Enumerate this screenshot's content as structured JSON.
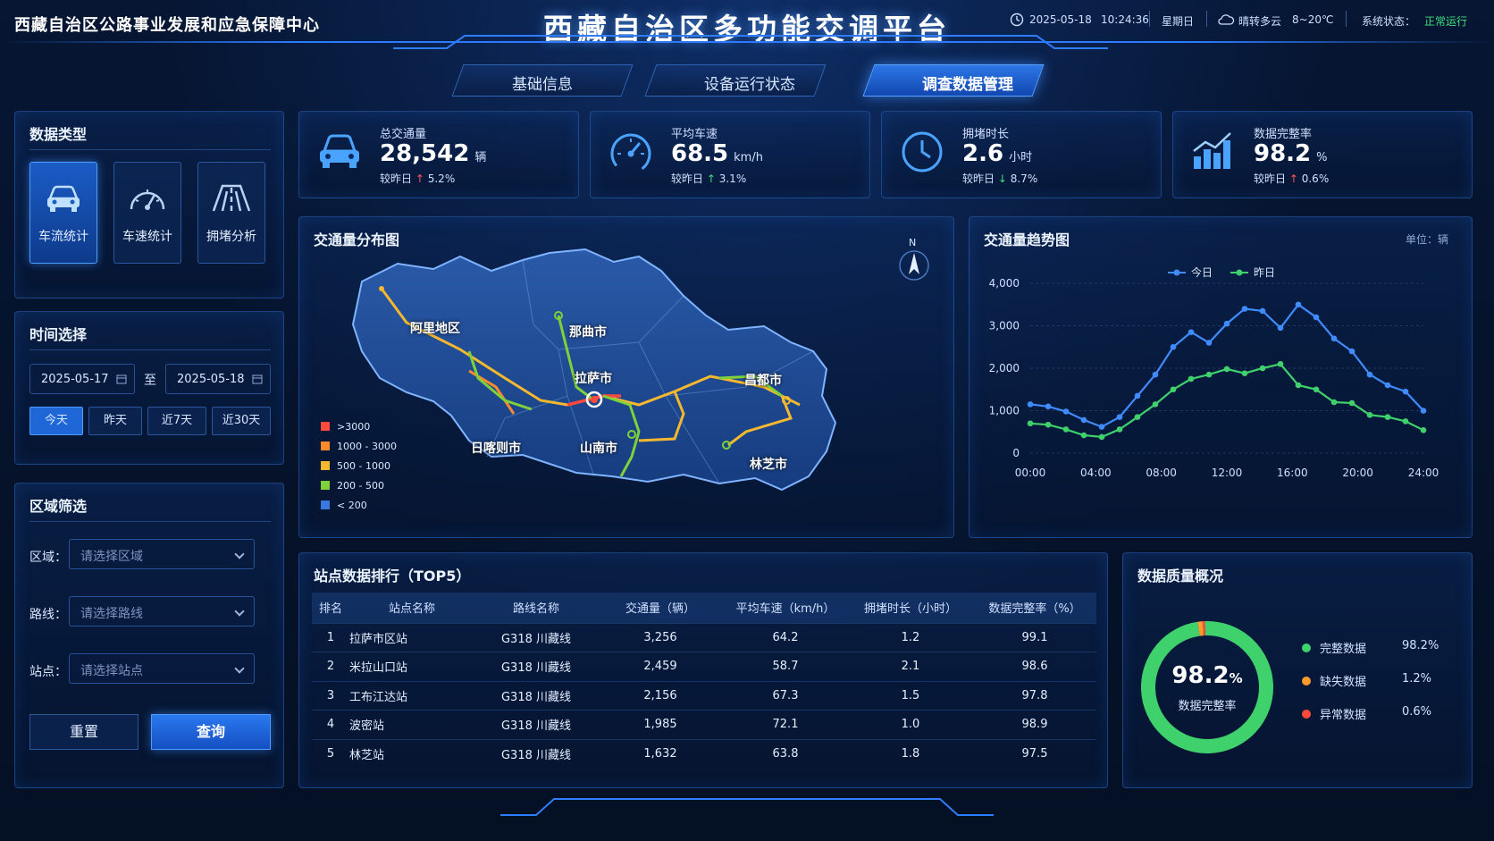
{
  "header": {
    "org": "西藏自治区公路事业发展和应急保障中心",
    "title": "西藏自治区多功能交调平台",
    "date": "2025-05-18",
    "time": "10:24:36",
    "weekday": "星期日",
    "weather": "晴转多云",
    "temp": "8~20℃",
    "status_label": "系统状态：",
    "status_value": "正常运行",
    "status_color": "#3fe07a"
  },
  "tabs": [
    {
      "label": "基础信息"
    },
    {
      "label": "设备运行状态"
    },
    {
      "label": "调查数据管理",
      "active": true
    }
  ],
  "left": {
    "type_title": "数据类型",
    "types": [
      {
        "label": "车流统计",
        "icon": "car-icon"
      },
      {
        "label": "车速统计",
        "icon": "speedometer-icon"
      },
      {
        "label": "拥堵分析",
        "icon": "road-icon"
      }
    ],
    "time_title": "时间选择",
    "date_from": "2025-05-17",
    "date_to": "2025-05-18",
    "to_label": "至",
    "quick": [
      "今天",
      "昨天",
      "近7天",
      "近30天"
    ],
    "region_title": "区域筛选",
    "filters": [
      {
        "label": "区域：",
        "placeholder": "请选择区域"
      },
      {
        "label": "路线：",
        "placeholder": "请选择路线"
      },
      {
        "label": "站点：",
        "placeholder": "请选择站点"
      }
    ],
    "reset": "重置",
    "query": "查询"
  },
  "stats": [
    {
      "label": "总交通量",
      "value": "28,542",
      "unit": "辆",
      "cmp": "较昨日",
      "dir": "up",
      "change": "5.2%",
      "icon": "car-icon"
    },
    {
      "label": "平均车速",
      "value": "68.5",
      "unit": "km/h",
      "cmp": "较昨日",
      "dir": "down-green-up",
      "change": "3.1%",
      "icon": "speedometer-icon"
    },
    {
      "label": "拥堵时长",
      "value": "2.6",
      "unit": "小时",
      "cmp": "较昨日",
      "dir": "down",
      "change": "8.7%",
      "icon": "clock-icon"
    },
    {
      "label": "数据完整率",
      "value": "98.2",
      "unit": "%",
      "cmp": "较昨日",
      "dir": "up",
      "change": "0.6%",
      "icon": "bar-chart-icon"
    }
  ],
  "map": {
    "title": "交通量分布图",
    "north": "N",
    "cities": [
      "阿里地区",
      "那曲市",
      "拉萨市",
      "昌都市",
      "日喀则市",
      "山南市",
      "林芝市"
    ],
    "legend": [
      {
        "label": ">3000",
        "color": "#ff4a3d"
      },
      {
        "label": "1000 - 3000",
        "color": "#ff8a2c"
      },
      {
        "label": "500 - 1000",
        "color": "#f5b82e"
      },
      {
        "label": "200 - 500",
        "color": "#7fd13b"
      },
      {
        "label": "< 200",
        "color": "#3a78e0"
      }
    ]
  },
  "trend": {
    "title": "交通量趋势图",
    "unit": "单位：辆"
  },
  "chart_data": {
    "type": "line",
    "x": [
      "00:00",
      "01:00",
      "02:00",
      "03:00",
      "04:00",
      "05:00",
      "06:00",
      "07:00",
      "08:00",
      "09:00",
      "10:00",
      "11:00",
      "12:00",
      "13:00",
      "14:00",
      "15:00",
      "16:00",
      "17:00",
      "18:00",
      "19:00",
      "20:00",
      "21:00",
      "22:00",
      "23:00",
      "24:00"
    ],
    "xticks": [
      "00:00",
      "04:00",
      "08:00",
      "12:00",
      "16:00",
      "20:00",
      "24:00"
    ],
    "yticks": [
      "0",
      "1,000",
      "2,000",
      "3,000",
      "4,000"
    ],
    "ylim": [
      0,
      4000
    ],
    "legend": "top-center",
    "series": [
      {
        "name": "今日",
        "color": "#3f8bff",
        "values": [
          1150,
          1100,
          980,
          780,
          620,
          850,
          1350,
          1850,
          2500,
          2850,
          2600,
          3050,
          3400,
          3350,
          2950,
          3500,
          3200,
          2700,
          2400,
          1850,
          1600,
          1450,
          1000
        ]
      },
      {
        "name": "昨日",
        "color": "#3fd16b",
        "values": [
          700,
          670,
          560,
          420,
          380,
          560,
          850,
          1150,
          1500,
          1750,
          1850,
          1980,
          1880,
          2000,
          2100,
          1600,
          1500,
          1200,
          1180,
          900,
          850,
          750,
          540
        ]
      }
    ]
  },
  "rank": {
    "title": "站点数据排行（TOP5）",
    "headers": [
      "排名",
      "站点名称",
      "路线名称",
      "交通量（辆）",
      "平均车速（km/h）",
      "拥堵时长（小时）",
      "数据完整率（%）"
    ],
    "rows": [
      [
        "1",
        "拉萨市区站",
        "G318 川藏线",
        "3,256",
        "64.2",
        "1.2",
        "99.1"
      ],
      [
        "2",
        "米拉山口站",
        "G318 川藏线",
        "2,459",
        "58.7",
        "2.1",
        "98.6"
      ],
      [
        "3",
        "工布江达站",
        "G318 川藏线",
        "2,156",
        "67.3",
        "1.5",
        "97.8"
      ],
      [
        "4",
        "波密站",
        "G318 川藏线",
        "1,985",
        "72.1",
        "1.0",
        "98.9"
      ],
      [
        "5",
        "林芝站",
        "G318 川藏线",
        "1,632",
        "63.8",
        "1.8",
        "97.5"
      ]
    ]
  },
  "quality": {
    "title": "数据质量概况",
    "center_value": "98.2",
    "center_unit": "%",
    "center_label": "数据完整率",
    "items": [
      {
        "label": "完整数据",
        "value": "98.2%",
        "color": "#3fd16b",
        "pct": 98.2
      },
      {
        "label": "缺失数据",
        "value": "1.2%",
        "color": "#ff9a2c",
        "pct": 1.2
      },
      {
        "label": "异常数据",
        "value": "0.6%",
        "color": "#ff4a3d",
        "pct": 0.6
      }
    ]
  }
}
